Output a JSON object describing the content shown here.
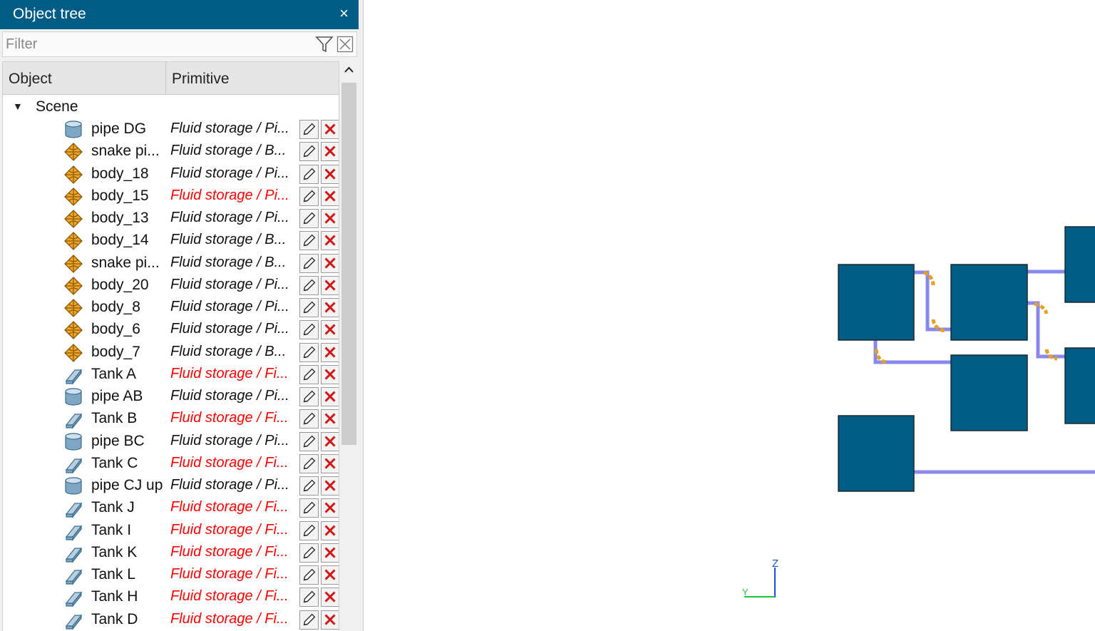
{
  "panel": {
    "title": "Object tree",
    "close_glyph": "×",
    "filter_placeholder": "Filter",
    "columns": {
      "object": "Object",
      "primitive": "Primitive"
    },
    "scene_label": "Scene",
    "rows": [
      {
        "name": "pipe DG",
        "icon": "cylinder-icon",
        "primitive": "Fluid storage / Pi...",
        "warning": false
      },
      {
        "name": "snake pi...",
        "icon": "mesh-body-icon",
        "primitive": "Fluid storage / B...",
        "warning": false
      },
      {
        "name": "body_18",
        "icon": "mesh-body-icon",
        "primitive": "Fluid storage / Pi...",
        "warning": false
      },
      {
        "name": "body_15",
        "icon": "mesh-body-icon",
        "primitive": "Fluid storage / Pi...",
        "warning": true
      },
      {
        "name": "body_13",
        "icon": "mesh-body-icon",
        "primitive": "Fluid storage / Pi...",
        "warning": false
      },
      {
        "name": "body_14",
        "icon": "mesh-body-icon",
        "primitive": "Fluid storage / B...",
        "warning": false
      },
      {
        "name": "snake pi...",
        "icon": "mesh-body-icon",
        "primitive": "Fluid storage / B...",
        "warning": false
      },
      {
        "name": "body_20",
        "icon": "mesh-body-icon",
        "primitive": "Fluid storage / Pi...",
        "warning": false
      },
      {
        "name": "body_8",
        "icon": "mesh-body-icon",
        "primitive": "Fluid storage / Pi...",
        "warning": false
      },
      {
        "name": "body_6",
        "icon": "mesh-body-icon",
        "primitive": "Fluid storage / Pi...",
        "warning": false
      },
      {
        "name": "body_7",
        "icon": "mesh-body-icon",
        "primitive": "Fluid storage / B...",
        "warning": false
      },
      {
        "name": "Tank A",
        "icon": "box-icon",
        "primitive": "Fluid storage / Fi...",
        "warning": true
      },
      {
        "name": "pipe AB",
        "icon": "cylinder-icon",
        "primitive": "Fluid storage / Pi...",
        "warning": false
      },
      {
        "name": "Tank B",
        "icon": "box-icon",
        "primitive": "Fluid storage / Fi...",
        "warning": true
      },
      {
        "name": "pipe BC",
        "icon": "cylinder-icon",
        "primitive": "Fluid storage / Pi...",
        "warning": false
      },
      {
        "name": "Tank C",
        "icon": "box-icon",
        "primitive": "Fluid storage / Fi...",
        "warning": true
      },
      {
        "name": "pipe CJ up",
        "icon": "cylinder-icon",
        "primitive": "Fluid storage / Pi...",
        "warning": false
      },
      {
        "name": "Tank J",
        "icon": "box-icon",
        "primitive": "Fluid storage / Fi...",
        "warning": true
      },
      {
        "name": "Tank I",
        "icon": "box-icon",
        "primitive": "Fluid storage / Fi...",
        "warning": true
      },
      {
        "name": "Tank K",
        "icon": "box-icon",
        "primitive": "Fluid storage / Fi...",
        "warning": true
      },
      {
        "name": "Tank L",
        "icon": "box-icon",
        "primitive": "Fluid storage / Fi...",
        "warning": true
      },
      {
        "name": "Tank H",
        "icon": "box-icon",
        "primitive": "Fluid storage / Fi...",
        "warning": true
      },
      {
        "name": "Tank D",
        "icon": "box-icon",
        "primitive": "Fluid storage / Fi...",
        "warning": true
      }
    ]
  },
  "viewport": {
    "axis_labels": {
      "z": "Z",
      "y": "Y"
    }
  },
  "colors": {
    "title_bar": "#005b85",
    "tank_fill": "#005b85",
    "pipe": "#8888ee",
    "bend": "#e8a020",
    "warning_text": "#ff0000",
    "axis_z": "#1a4fd8",
    "axis_y": "#20c040"
  }
}
